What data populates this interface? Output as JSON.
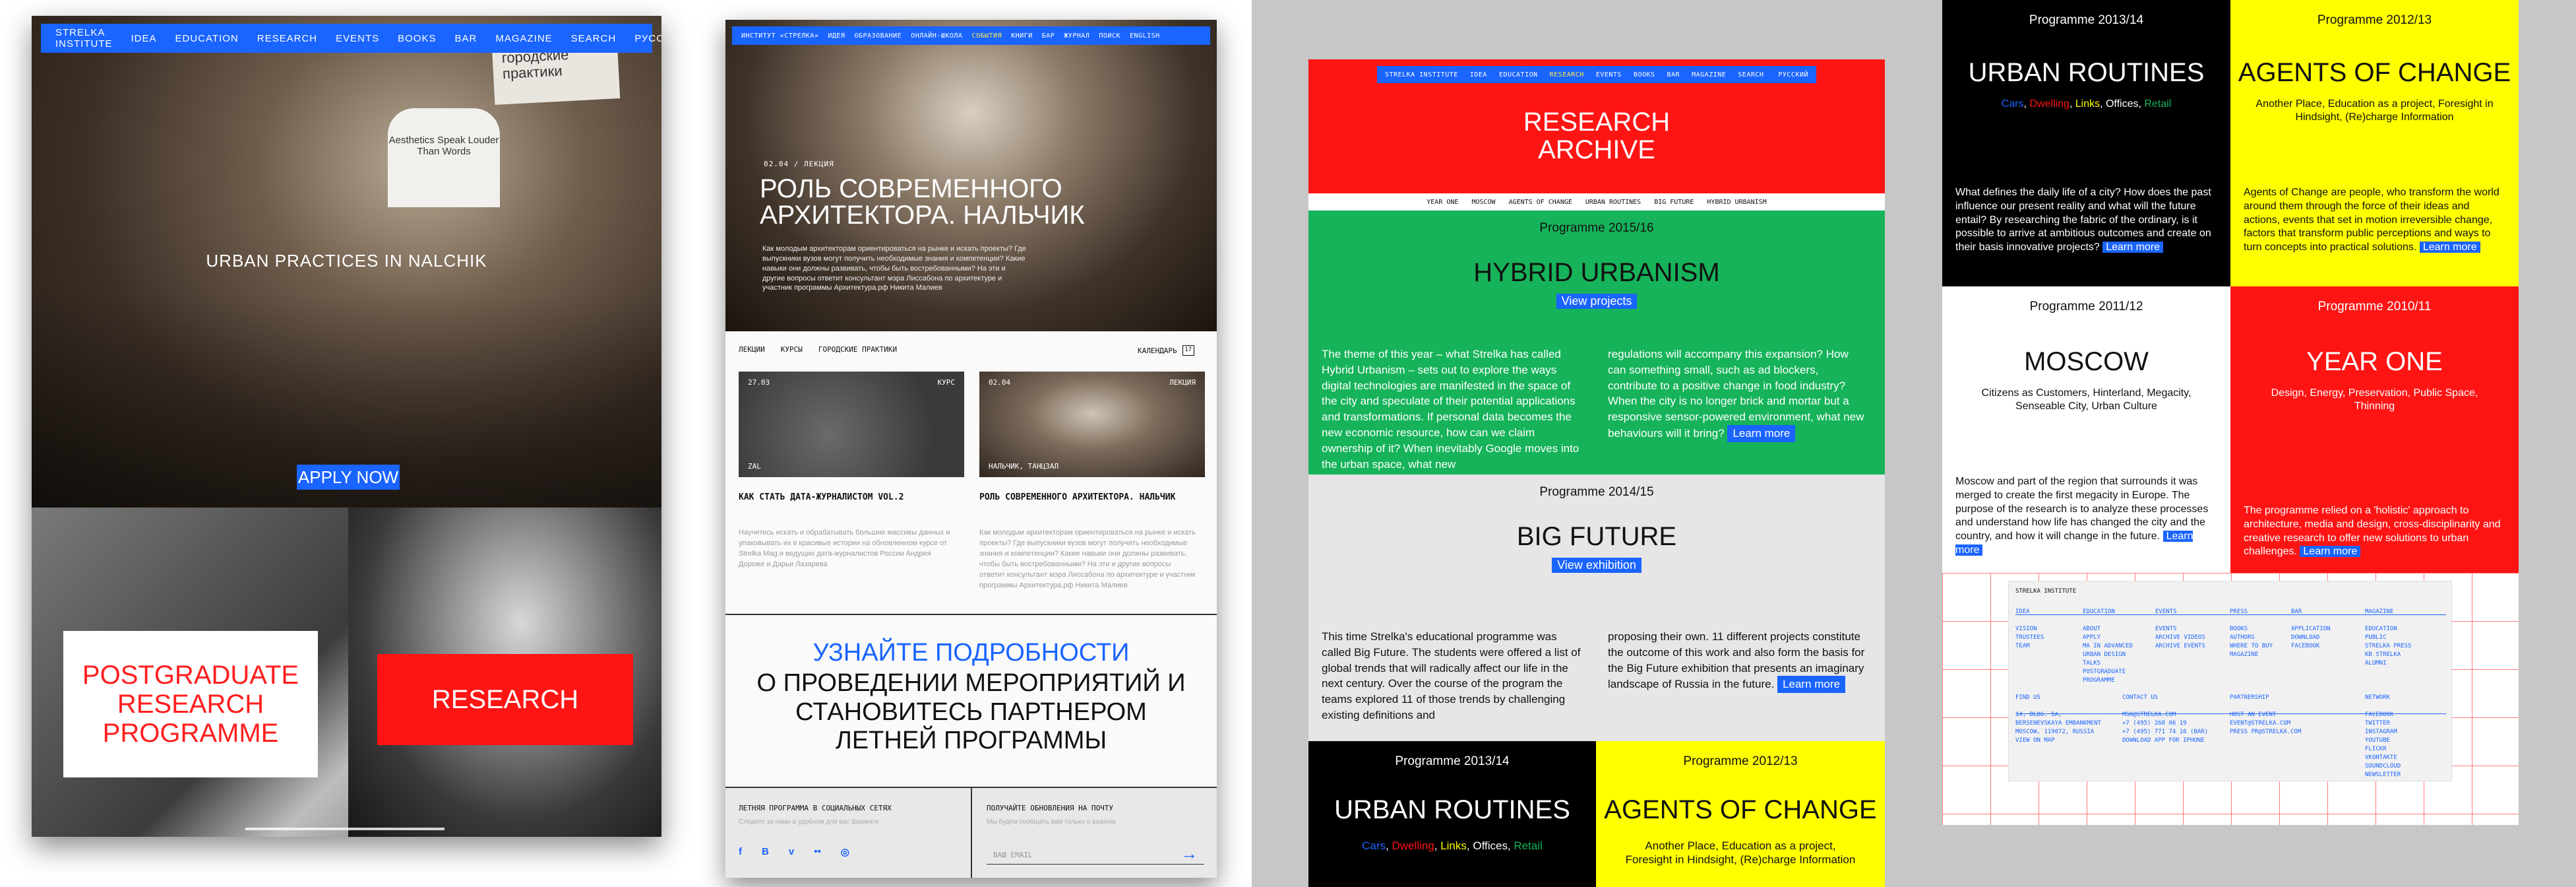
{
  "panel1": {
    "nav": [
      "STRELKA INSTITUTE",
      "IDEA",
      "EDUCATION",
      "RESEARCH",
      "EVENTS",
      "BOOKS",
      "BAR",
      "MAGAZINE",
      "SEARCH"
    ],
    "lang": "РУССКИЙ",
    "hero_text": "URBAN PRACTICES IN NALCHIK",
    "apply": "APPLY NOW",
    "tshirt_text": "Aesthetics Speak Louder Than Words",
    "sign_text": "городские практики",
    "postgraduate": "POSTGRADUATE RESEARCH PROGRAMME",
    "research": "RESEARCH"
  },
  "panel2": {
    "nav": [
      "ИНСТИТУТ «СТРЕЛКА»",
      "ИДЕЯ",
      "ОБРАЗОВАНИЕ",
      "ОНЛАЙН-ШКОЛА",
      "СОБЫТИЯ",
      "КНИГИ",
      "БАР",
      "ЖУРНАЛ",
      "ПОИСК",
      "ENGLISH"
    ],
    "nav_active": "СОБЫТИЯ",
    "date": "02.04 / ЛЕКЦИЯ",
    "title": "РОЛЬ СОВРЕМЕННОГО АРХИТЕКТОРА. НАЛЬЧИК",
    "description": "Как молодым архитекторам ориентироваться на рынке и искать проекты? Где выпускники вузов могут получить необходимые знания и компетенции? Какие навыки они должны развивать, чтобы быть востребованными? На эти и другие вопросы ответит консультант мэра Лиссабона по архитектуре и участник программы Архитектура.рф Никита Малиев",
    "tabs": [
      "ЛЕКЦИИ",
      "КУРСЫ",
      "ГОРОДСКИЕ ПРАКТИКИ"
    ],
    "calendar": "КАЛЕНДАРЬ",
    "calendar_num": "17",
    "cards": [
      {
        "date": "27.03",
        "kind": "КУРС",
        "label": "ZAL",
        "title": "КАК СТАТЬ ДАТА-ЖУРНАЛИСТОМ VOL.2",
        "desc": "Научитесь искать и обрабатывать большие массивы данных и упаковывать их в красивые истории на обновленном курсе от Strelka Mag и ведущих дата-журналистов России Андрея Дороже и Дарьи Лазарева"
      },
      {
        "date": "02.04",
        "kind": "ЛЕКЦИЯ",
        "label": "НАЛЬЧИК, ТАНЦЗАЛ",
        "title": "РОЛЬ СОВРЕМЕННОГО АРХИТЕКТОРА. НАЛЬЧИК",
        "desc": "Как молодым архитекторам ориентироваться на рынке и искать проекты? Где выпускники вузов могут получить необходимые знания и компетенции? Какие навыки они должны развивать, чтобы быть востребованными? На эти и другие вопросы ответит консультант мэра Лиссабона по архитектуре и участник программы Архитектура.рф Никита Малиев"
      }
    ],
    "cta_blue": "УЗНАЙТЕ ПОДРОБНОСТИ",
    "cta_black": "О ПРОВЕДЕНИИ МЕРОПРИЯТИЙ И СТАНОВИТЕСЬ ПАРТНЕРОМ ЛЕТНЕЙ ПРОГРАММЫ",
    "footer_social_title": "ЛЕТНЯЯ ПРОГРАММА В СОЦИАЛЬНЫХ СЕТЯХ",
    "footer_social_sub": "Следите за нами в удобном для вас формате",
    "footer_mail_title": "ПОЛУЧАЙТЕ ОБНОВЛЕНИЯ НА ПОЧТУ",
    "footer_mail_sub": "Мы будем сообщать вам только о важном",
    "social": [
      "f",
      "B",
      "v",
      "••",
      "◎"
    ],
    "email_placeholder": "ВАШ EMAIL"
  },
  "panel3": {
    "nav": [
      "STRELKA INSTITUTE",
      "IDEA",
      "EDUCATION",
      "RESEARCH",
      "EVENTS",
      "BOOKS",
      "BAR",
      "MAGAZINE",
      "SEARCH"
    ],
    "nav_active": "RESEARCH",
    "lang": "РУССКИЙ",
    "title_line1": "RESEARCH",
    "title_line2": "ARCHIVE",
    "subnav": [
      "YEAR ONE",
      "MOSCOW",
      "AGENTS OF CHANGE",
      "URBAN ROUTINES",
      "BIG FUTURE",
      "HYBRID URBANISM"
    ],
    "hybrid": {
      "programme": "Programme 2015/16",
      "title": "HYBRID URBANISM",
      "button": "View projects",
      "col1": "The theme of this year – what Strelka has called Hybrid Urbanism – sets out to explore the ways digital technologies are manifested in the space of the city and speculate of their potential applications and transformations. If personal data becomes the new economic resource, how can we claim ownership of it? When inevitably Google moves into the urban space, what new",
      "col2": "regulations will accompany this expansion? How can something small, such as ad blockers, contribute to a positive change in food industry? When the city is no longer brick and mortar but a responsive sensor-powered environment, what new behaviours will it bring?",
      "learn": "Learn more"
    },
    "bigfuture": {
      "programme": "Programme 2014/15",
      "title": "BIG FUTURE",
      "button": "View exhibition",
      "col1": "This time Strelka's educational programme was called Big Future. The students were offered a list of global trends that will radically affect our life in the next century. Over the course of the program the teams explored 11 of those trends by challenging existing definitions and",
      "col2": "proposing their own. 11 different projects constitute the outcome of this work and also form the basis for the Big Future exhibition that presents an imaginary landscape of Russia in the future.",
      "learn": "Learn more"
    },
    "urban": {
      "programme": "Programme 2013/14",
      "title": "URBAN ROUTINES",
      "tags": [
        "Cars",
        "Dwelling",
        "Links",
        "Offices",
        "Retail"
      ]
    },
    "agents": {
      "programme": "Programme 2012/13",
      "title": "AGENTS OF CHANGE",
      "sub": "Another Place, Education as a project, Foresight in Hindsight, (Re)charge Information"
    }
  },
  "panel4": {
    "urban": {
      "programme": "Programme 2013/14",
      "title": "URBAN ROUTINES",
      "tags": [
        "Cars",
        "Dwelling",
        "Links",
        "Offices",
        "Retail"
      ],
      "desc": "What defines the daily life of a city? How does the past influence our present reality and what will the future entail? By researching the fabric of the ordinary, is it possible to arrive at ambitious outcomes and create on their basis innovative projects?",
      "learn": "Learn more"
    },
    "agents": {
      "programme": "Programme 2012/13",
      "title": "AGENTS OF CHANGE",
      "sub": "Another Place, Education as a project, Foresight in Hindsight, (Re)charge Information",
      "desc": "Agents of Change are people, who transform the world around them through the force of their ideas and actions, events that set in motion irreversible change, factors that transform public perceptions and ways to turn concepts into practical solutions.",
      "learn": "Learn more"
    },
    "moscow": {
      "programme": "Programme 2011/12",
      "title": "MOSCOW",
      "sub": "Citizens as Customers, Hinterland, Megacity, Senseable City, Urban Culture",
      "desc": "Moscow and part of the region that surrounds it was merged to create the first megacity in Europe. The purpose of the research is to analyze these processes and understand how life has changed the city and the country, and how it will change in the future.",
      "learn": "Learn more"
    },
    "yearone": {
      "programme": "Programme 2010/11",
      "title": "YEAR ONE",
      "sub": "Design, Energy, Preservation, Public Space, Thinning",
      "desc": "The programme relied on a 'holistic' approach to architecture, media and design, cross-disciplinarity and creative research to offer new solutions to urban challenges.",
      "learn": "Learn more"
    },
    "footer": {
      "brand": "STRELKA INSTITUTE",
      "columns": [
        {
          "head": "IDEA",
          "items": [
            "VISION",
            "TRUSTEES",
            "TEAM"
          ]
        },
        {
          "head": "EDUCATION",
          "items": [
            "ABOUT",
            "APPLY",
            "MA IN ADVANCED",
            "URBAN DESIGN",
            "TALKS",
            "POSTGRADUATE",
            "PROGRAMME"
          ]
        },
        {
          "head": "EVENTS",
          "items": [
            "EVENTS",
            "ARCHIVE VIDEOS",
            "ARCHIVE EVENTS"
          ]
        },
        {
          "head": "PRESS",
          "items": [
            "BOOKS",
            "AUTHORS",
            "WHERE TO BUY",
            "MAGAZINE"
          ]
        },
        {
          "head": "BAR",
          "items": [
            "APPLICATION",
            "DOWNLOAD",
            "FACEBOOK"
          ]
        },
        {
          "head": "MAGAZINE",
          "items": [
            "EDUCATION",
            "PUBLIC",
            "STRELKA PRESS",
            "KB STRELKA",
            "ALUMNI"
          ]
        }
      ],
      "find_head": "FIND US",
      "find": [
        "14, BLDG. 5A,",
        "BERSENEVSKAYA EMBANKMENT",
        "MOSCOW, 119072, RUSSIA",
        "VIEW ON MAP"
      ],
      "contact_head": "CONTACT US",
      "contact": [
        "MSK@STRELKA.COM",
        "+7 (495) 268 06 19",
        "+7 (495) 771 74 16 (BAR)",
        "DOWNLOAD APP FOR IPHONE"
      ],
      "partner_head": "PARTNERSHIP",
      "partner": [
        "HOST AN EVENT",
        "EVENT@STRELKA.COM",
        "PRESS PR@STRELKA.COM"
      ],
      "network_head": "NETWORK",
      "network": [
        "FACEBOOK",
        "TWITTER",
        "INSTAGRAM",
        "YOUTUBE",
        "FLICKR",
        "VKONTAKTE",
        "SOUNDCLOUD",
        "NEWSLETTER"
      ]
    }
  },
  "colors": {
    "blue": "#1a64ff",
    "red": "#ff1414",
    "green": "#16b35a",
    "yellow": "#ffff00",
    "tag_cars": "#1a64ff",
    "tag_dwelling": "#ff1414",
    "tag_links": "#ffff00",
    "tag_offices": "#ffffff",
    "tag_retail": "#16b35a"
  }
}
